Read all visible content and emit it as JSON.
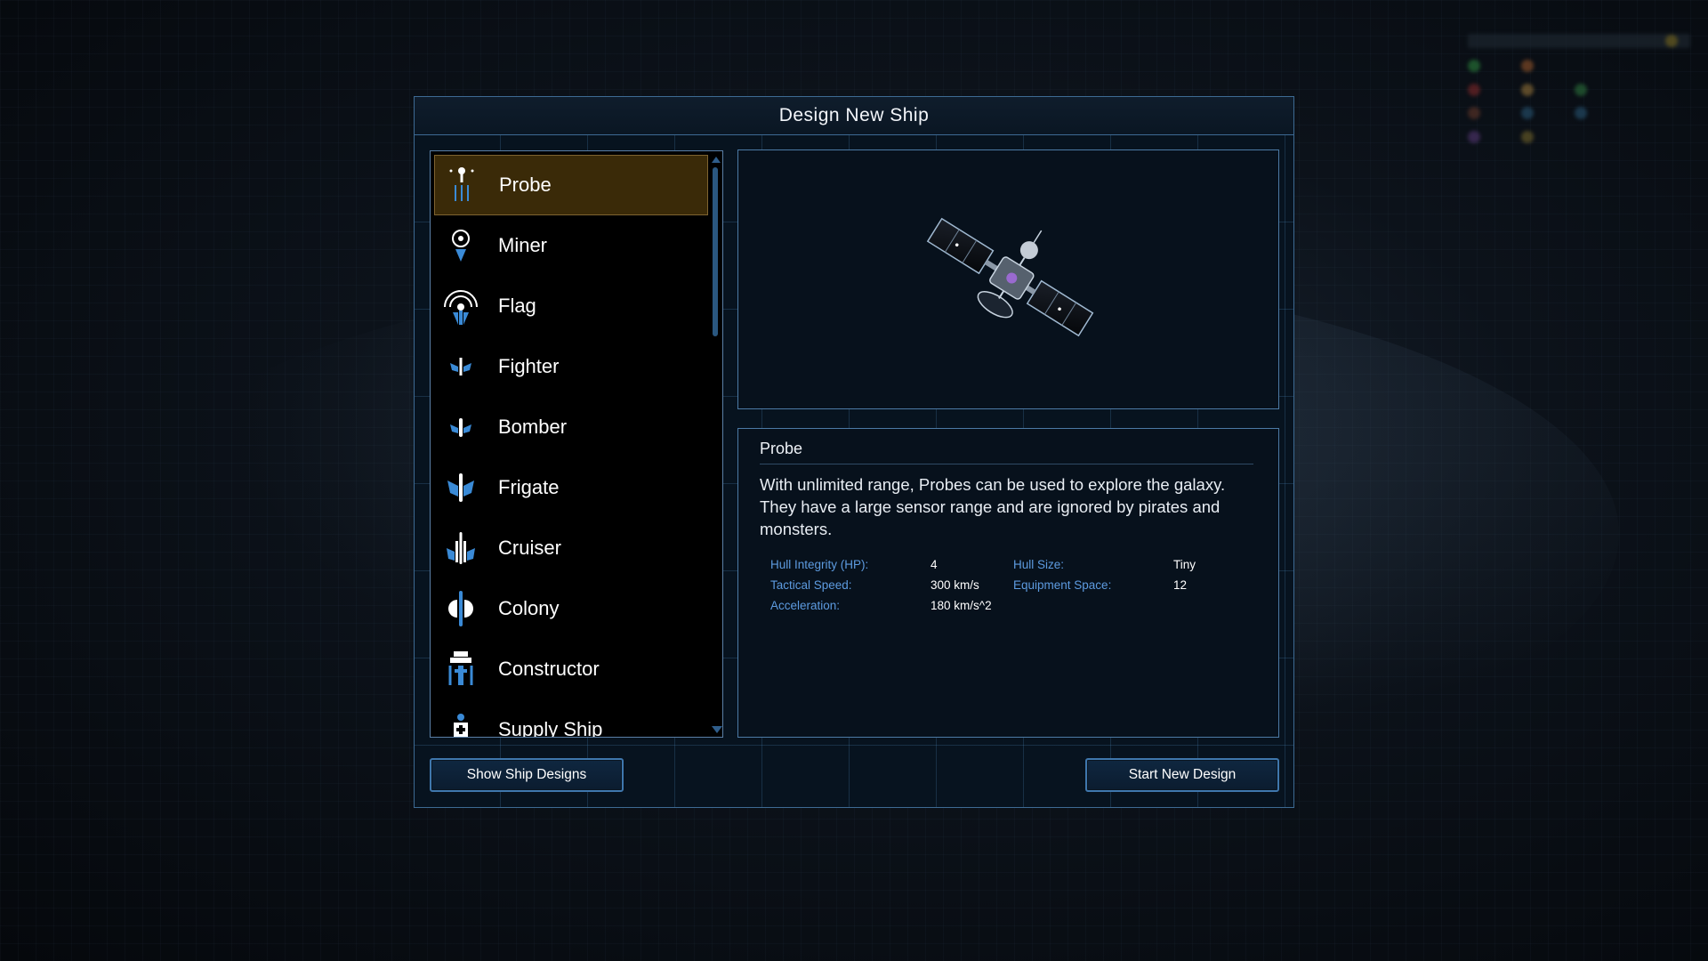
{
  "dialog": {
    "title": "Design New Ship"
  },
  "ship_types": [
    {
      "label": "Probe",
      "icon": "probe-icon",
      "selected": true
    },
    {
      "label": "Miner",
      "icon": "miner-icon",
      "selected": false
    },
    {
      "label": "Flag",
      "icon": "flag-icon",
      "selected": false
    },
    {
      "label": "Fighter",
      "icon": "fighter-icon",
      "selected": false
    },
    {
      "label": "Bomber",
      "icon": "bomber-icon",
      "selected": false
    },
    {
      "label": "Frigate",
      "icon": "frigate-icon",
      "selected": false
    },
    {
      "label": "Cruiser",
      "icon": "cruiser-icon",
      "selected": false
    },
    {
      "label": "Colony",
      "icon": "colony-icon",
      "selected": false
    },
    {
      "label": "Constructor",
      "icon": "constructor-icon",
      "selected": false
    },
    {
      "label": "Supply Ship",
      "icon": "supply-ship-icon",
      "selected": false
    }
  ],
  "details": {
    "name": "Probe",
    "description": "With unlimited range, Probes can be used to explore the galaxy. They have a large sensor range and are ignored by pirates and monsters.",
    "stats": {
      "hull_integrity_label": "Hull Integrity (HP):",
      "hull_integrity_value": "4",
      "hull_size_label": "Hull Size:",
      "hull_size_value": "Tiny",
      "tactical_speed_label": "Tactical Speed:",
      "tactical_speed_value": "300 km/s",
      "equipment_space_label": "Equipment Space:",
      "equipment_space_value": "12",
      "acceleration_label": "Acceleration:",
      "acceleration_value": "180 km/s^2"
    }
  },
  "buttons": {
    "show_designs": "Show Ship Designs",
    "start_design": "Start New Design"
  },
  "colors": {
    "accent_blue": "#3f77ad",
    "selected_bg": "#3a2a08",
    "stat_label": "#5d9be0"
  }
}
